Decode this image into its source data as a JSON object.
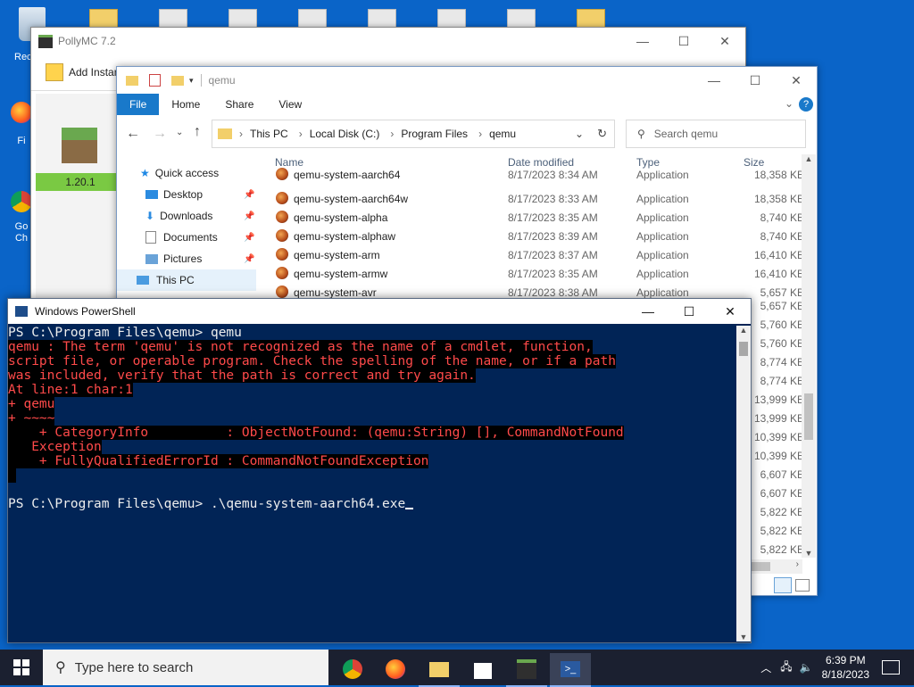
{
  "desktop": {
    "recycle_label": "Recy",
    "firefox_label": "Fi",
    "chrome_label": "Go\nCh"
  },
  "polly": {
    "title": "PollyMC 7.2",
    "add_instance": "Add Instan",
    "version": "1.20.1"
  },
  "explorer": {
    "title": "qemu",
    "ribbon_tabs": [
      "File",
      "Home",
      "Share",
      "View"
    ],
    "breadcrumb": [
      "This PC",
      "Local Disk (C:)",
      "Program Files",
      "qemu"
    ],
    "search_placeholder": "Search qemu",
    "nav": {
      "quick_access": "Quick access",
      "desktop": "Desktop",
      "downloads": "Downloads",
      "documents": "Documents",
      "pictures": "Pictures",
      "this_pc": "This PC"
    },
    "columns": {
      "name": "Name",
      "date": "Date modified",
      "type": "Type",
      "size": "Size"
    },
    "files": [
      {
        "name": "qemu-system-aarch64",
        "date": "8/17/2023 8:34 AM",
        "type": "Application",
        "size": "18,358 KB"
      },
      {
        "name": "qemu-system-aarch64w",
        "date": "8/17/2023 8:33 AM",
        "type": "Application",
        "size": "18,358 KB"
      },
      {
        "name": "qemu-system-alpha",
        "date": "8/17/2023 8:35 AM",
        "type": "Application",
        "size": "8,740 KB"
      },
      {
        "name": "qemu-system-alphaw",
        "date": "8/17/2023 8:39 AM",
        "type": "Application",
        "size": "8,740 KB"
      },
      {
        "name": "qemu-system-arm",
        "date": "8/17/2023 8:37 AM",
        "type": "Application",
        "size": "16,410 KB"
      },
      {
        "name": "qemu-system-armw",
        "date": "8/17/2023 8:35 AM",
        "type": "Application",
        "size": "16,410 KB"
      },
      {
        "name": "qemu-system-avr",
        "date": "8/17/2023 8:38 AM",
        "type": "Application",
        "size": "5,657 KB"
      }
    ],
    "hidden_sizes": [
      "5,657 KB",
      "5,760 KB",
      "5,760 KB",
      "8,774 KB",
      "8,774 KB",
      "13,999 KB",
      "13,999 KB",
      "10,399 KB",
      "10,399 KB",
      "6,607 KB",
      "6,607 KB",
      "5,822 KB",
      "5,822 KB",
      "5,822 KB"
    ]
  },
  "powershell": {
    "title": "Windows PowerShell",
    "lines": [
      {
        "text": "PS C:\\Program Files\\qemu> qemu",
        "style": "normal"
      },
      {
        "text": "qemu : The term 'qemu' is not recognized as the name of a cmdlet, function,",
        "style": "err"
      },
      {
        "text": "script file, or operable program. Check the spelling of the name, or if a path",
        "style": "err"
      },
      {
        "text": "was included, verify that the path is correct and try again.",
        "style": "err"
      },
      {
        "text": "At line:1 char:1",
        "style": "err"
      },
      {
        "text": "+ qemu",
        "style": "err"
      },
      {
        "text": "+ ~~~~",
        "style": "err"
      },
      {
        "text": "    + CategoryInfo          : ObjectNotFound: (qemu:String) [], CommandNotFound",
        "style": "err"
      },
      {
        "text": "   Exception",
        "style": "err"
      },
      {
        "text": "    + FullyQualifiedErrorId : CommandNotFoundException",
        "style": "err"
      },
      {
        "text": " ",
        "style": "err"
      },
      {
        "text": "",
        "style": "normal"
      },
      {
        "text": "PS C:\\Program Files\\qemu> .\\qemu-system-aarch64.exe",
        "style": "normal"
      }
    ]
  },
  "taskbar": {
    "search_placeholder": "Type here to search",
    "time": "6:39 PM",
    "date": "8/18/2023"
  },
  "colors": {
    "desktop_bg": "#0a64c8",
    "ps_bg": "#012456",
    "error_red": "#ff4a4a",
    "explorer_accent": "#1979ca"
  }
}
